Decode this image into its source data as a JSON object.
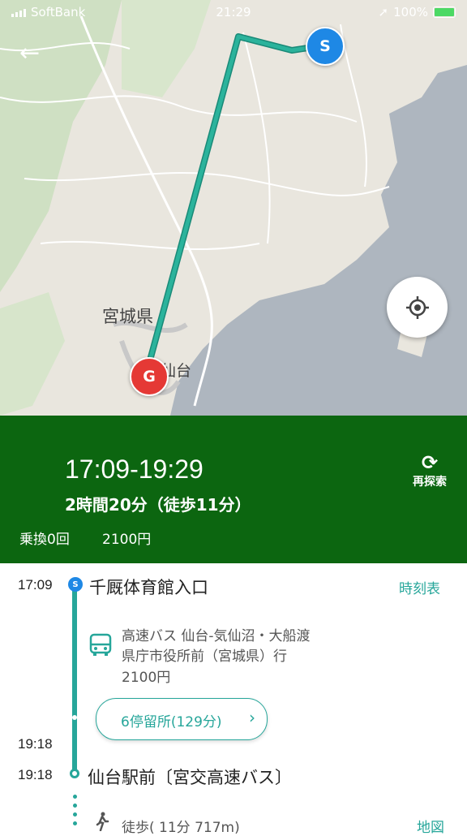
{
  "status_bar": {
    "carrier": "SoftBank",
    "time": "21:29",
    "battery": "100%"
  },
  "map": {
    "labels": {
      "prefecture": "宮城県",
      "city": "仙台"
    },
    "start_marker": "S",
    "goal_marker": "G",
    "route_color": "#26a69a"
  },
  "summary": {
    "time_range": "17:09-19:29",
    "duration": "2時間20分（徒歩11分）",
    "transfers": "乗換0回",
    "fare": "2100円",
    "research_label": "再探索",
    "background": "#0c6610"
  },
  "route": {
    "depart_time": "17:09",
    "depart_marker": "S",
    "depart_stop": "千厩体育館入口",
    "timetable_link": "時刻表",
    "bus_line": "高速バス 仙台-気仙沼・大船渡",
    "bus_destination": "県庁市役所前（宮城県）行",
    "bus_fare": "2100円",
    "stops_button": "6停留所(129分)",
    "arrive_time_1": "19:18",
    "arrive_time_2": "19:18",
    "arrive_stop": "仙台駅前〔宮交高速バス〕",
    "walk_text": "徒歩( 11分 717m)",
    "map_link": "地図"
  }
}
